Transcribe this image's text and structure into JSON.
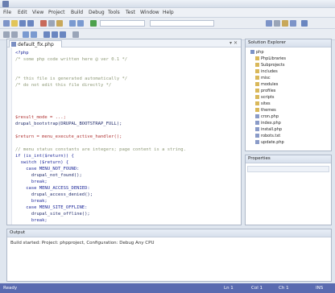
{
  "window": {
    "title": ""
  },
  "menu": {
    "items": [
      "File",
      "Edit",
      "View",
      "Project",
      "Build",
      "Debug",
      "Tools",
      "Test",
      "Window",
      "Help"
    ]
  },
  "editor": {
    "tab_label": "default_fix.php",
    "lines": [
      "<?php",
      "/* some php code written here @ ver 0.1 */",
      "",
      "",
      "/* this file is generated automatically */",
      "/* do not edit this file directly */",
      "",
      "",
      "",
      "",
      "$result_mode = ...;",
      "drupal_bootstrap(DRUPAL_BOOTSTRAP_FULL);",
      "",
      "$return = menu_execute_active_handler();",
      "",
      "// menu status constants are integers; page content is a string.",
      "if (is_int($return)) {",
      "  switch ($return) {",
      "    case MENU_NOT_FOUND:",
      "      drupal_not_found();",
      "      break;",
      "    case MENU_ACCESS_DENIED:",
      "      drupal_access_denied();",
      "      break;",
      "    case MENU_SITE_OFFLINE:",
      "      drupal_site_offline();",
      "      break;",
      "  }",
      "}"
    ]
  },
  "explorer": {
    "title": "Solution Explorer",
    "items": [
      "php",
      "PhpLibraries",
      "Subprojects",
      "includes",
      "misc",
      "modules",
      "profiles",
      "scripts",
      "sites",
      "themes",
      "cron.php",
      "index.php",
      "install.php",
      "robots.txt",
      "update.php",
      "xmlrpc.php"
    ]
  },
  "properties": {
    "title": "Properties"
  },
  "output": {
    "title": "Output",
    "text": "Build started: Project: phpproject, Configuration: Debug Any CPU"
  },
  "status": {
    "left": "Ready",
    "ln": "Ln 1",
    "col": "Col 1",
    "ch": "Ch 1",
    "mode": "INS"
  }
}
